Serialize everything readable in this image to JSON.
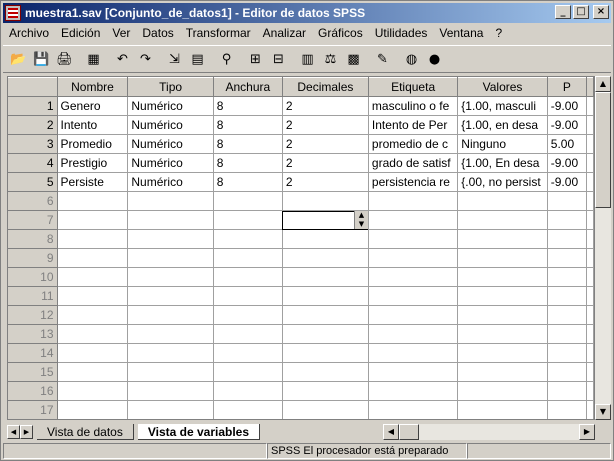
{
  "window": {
    "title": "muestra1.sav [Conjunto_de_datos1] - Editor de datos SPSS"
  },
  "menu": [
    "Archivo",
    "Edición",
    "Ver",
    "Datos",
    "Transformar",
    "Analizar",
    "Gráficos",
    "Utilidades",
    "Ventana",
    "?"
  ],
  "toolbar": [
    {
      "name": "open-icon",
      "glyph": "📂"
    },
    {
      "name": "save-icon",
      "glyph": "💾"
    },
    {
      "name": "print-icon",
      "glyph": "🖨"
    },
    {
      "name": "dialog-recall-icon",
      "glyph": "▦"
    },
    {
      "name": "undo-icon",
      "glyph": "↶"
    },
    {
      "name": "redo-icon",
      "glyph": "↷"
    },
    {
      "name": "goto-case-icon",
      "glyph": "⇲"
    },
    {
      "name": "variables-icon",
      "glyph": "▤"
    },
    {
      "name": "find-icon",
      "glyph": "⚲"
    },
    {
      "name": "insert-cases-icon",
      "glyph": "⊞"
    },
    {
      "name": "insert-variable-icon",
      "glyph": "⊟"
    },
    {
      "name": "split-file-icon",
      "glyph": "▥"
    },
    {
      "name": "weight-cases-icon",
      "glyph": "⚖"
    },
    {
      "name": "select-cases-icon",
      "glyph": "▩"
    },
    {
      "name": "value-labels-icon",
      "glyph": "✎"
    },
    {
      "name": "use-sets-icon",
      "glyph": "◍"
    },
    {
      "name": "show-all-icon",
      "glyph": "●"
    }
  ],
  "grid": {
    "columns": [
      "Nombre",
      "Tipo",
      "Anchura",
      "Decimales",
      "Etiqueta",
      "Valores",
      "P"
    ],
    "rows": [
      {
        "n": "1",
        "cells": [
          "Genero",
          "Numérico",
          "8",
          "2",
          "masculino o fe",
          "{1.00, masculi",
          "-9.00"
        ]
      },
      {
        "n": "2",
        "cells": [
          "Intento",
          "Numérico",
          "8",
          "2",
          "Intento de Per",
          "{1.00, en desa",
          "-9.00"
        ]
      },
      {
        "n": "3",
        "cells": [
          "Promedio",
          "Numérico",
          "8",
          "2",
          "promedio de c",
          "Ninguno",
          "5.00"
        ]
      },
      {
        "n": "4",
        "cells": [
          "Prestigio",
          "Numérico",
          "8",
          "2",
          "grado de satisf",
          "{1.00, En desa",
          "-9.00"
        ]
      },
      {
        "n": "5",
        "cells": [
          "Persiste",
          "Numérico",
          "8",
          "2",
          "persistencia re",
          "{.00, no persist",
          "-9.00"
        ]
      }
    ],
    "empty_rows": [
      "6",
      "7",
      "8",
      "9",
      "10",
      "11",
      "12",
      "13",
      "14",
      "15",
      "16",
      "17"
    ]
  },
  "tabs": {
    "data_view": "Vista de datos",
    "variable_view": "Vista de variables"
  },
  "status": {
    "processor": "SPSS El procesador  está preparado"
  }
}
